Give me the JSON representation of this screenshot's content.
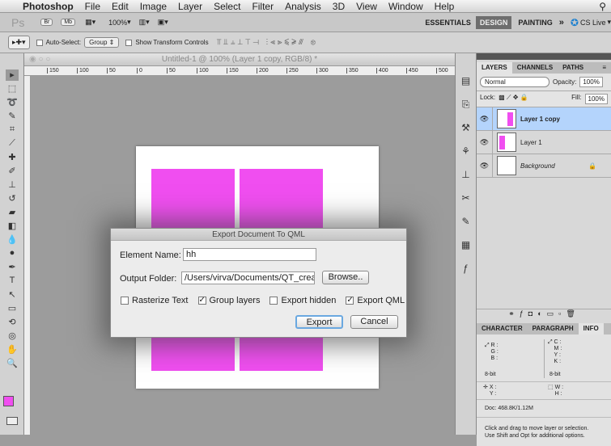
{
  "menubar": {
    "apple": "",
    "app": "Photoshop",
    "items": [
      "File",
      "Edit",
      "Image",
      "Layer",
      "Select",
      "Filter",
      "Analysis",
      "3D",
      "View",
      "Window",
      "Help"
    ]
  },
  "appbar": {
    "ps": "Ps",
    "br": "Br",
    "mb": "Mb",
    "zoom": "100%",
    "workspaces": [
      "ESSENTIALS",
      "DESIGN",
      "PAINTING"
    ],
    "more": "»",
    "cslive": "CS Live"
  },
  "options": {
    "auto_select": "Auto-Select:",
    "group": "Group",
    "show_transform": "Show Transform Controls"
  },
  "document": {
    "title": "Untitled-1 @ 100% (Layer 1 copy, RGB/8) *",
    "ruler": [
      "150",
      "100",
      "50",
      "0",
      "50",
      "100",
      "150",
      "200",
      "250",
      "300",
      "350",
      "400",
      "450",
      "500"
    ]
  },
  "dialog": {
    "title": "Export Document To QML",
    "element_label": "Element Name:",
    "element_value": "hh",
    "folder_label": "Output Folder:",
    "folder_value": "/Users/virva/Documents/QT_crea",
    "browse": "Browse..",
    "options": [
      {
        "label": "Rasterize Text",
        "checked": false
      },
      {
        "label": "Group layers",
        "checked": true
      },
      {
        "label": "Export hidden",
        "checked": false
      },
      {
        "label": "Export QML",
        "checked": true
      }
    ],
    "export": "Export",
    "cancel": "Cancel"
  },
  "layers": {
    "tabs": [
      "LAYERS",
      "CHANNELS",
      "PATHS"
    ],
    "blend": "Normal",
    "opacity_label": "Opacity:",
    "opacity": "100%",
    "lock_label": "Lock:",
    "fill_label": "Fill:",
    "fill": "100%",
    "items": [
      "Layer 1 copy",
      "Layer 1",
      "Background"
    ]
  },
  "info": {
    "tabs": [
      "CHARACTER",
      "PARAGRAPH",
      "INFO"
    ],
    "rgb": [
      "R :",
      "G :",
      "B :"
    ],
    "cmyk": [
      "C :",
      "M :",
      "Y :",
      "K :"
    ],
    "bit1": "8-bit",
    "bit2": "8-bit",
    "xy": [
      "X :",
      "Y :"
    ],
    "wh": [
      "W :",
      "H :"
    ],
    "doc": "Doc: 468.8K/1.12M",
    "hint1": "Click and drag to move layer or selection.",
    "hint2": "Use Shift and Opt for additional options."
  },
  "colors": {
    "pink": "#f04ef0",
    "selected": "#b4d4fc"
  }
}
